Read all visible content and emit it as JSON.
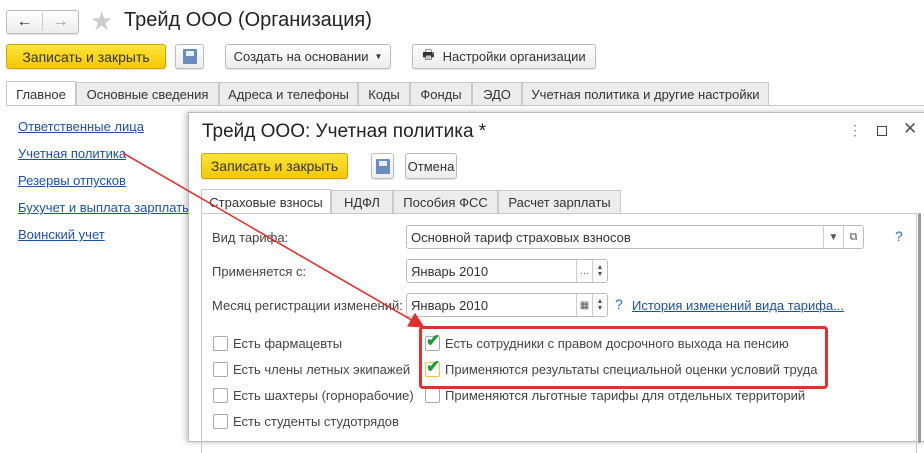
{
  "main": {
    "title": "Трейд ООО (Организация)",
    "save_close": "Записать и закрыть",
    "create_based": "Создать на основании",
    "org_settings": "Настройки организации",
    "tabs": [
      "Главное",
      "Основные сведения",
      "Адреса и телефоны",
      "Коды",
      "Фонды",
      "ЭДО",
      "Учетная политика и другие настройки"
    ]
  },
  "sidebar": {
    "links": [
      "Ответственные лица",
      "Учетная политика",
      "Резервы отпусков",
      "Бухучет и выплата зарплаты",
      "Воинский учет"
    ]
  },
  "dialog": {
    "title": "Трейд ООО: Учетная политика *",
    "save_close": "Записать и закрыть",
    "cancel": "Отмена",
    "tabs": [
      "Страховые взносы",
      "НДФЛ",
      "Пособия ФСС",
      "Расчет зарплаты"
    ],
    "fields": {
      "tariff_label": "Вид тарифа:",
      "tariff_value": "Основной тариф страховых взносов",
      "applies_label": "Применяется с:",
      "applies_value": "Январь 2010",
      "month_label": "Месяц регистрации изменений:",
      "month_value": "Январь 2010",
      "help": "?",
      "history_link": "История изменений вида тарифа..."
    },
    "checkboxes_left": [
      {
        "label": "Есть фармацевты",
        "checked": false
      },
      {
        "label": "Есть члены летных экипажей",
        "checked": false
      },
      {
        "label": "Есть шахтеры (горнорабочие)",
        "checked": false
      },
      {
        "label": "Есть студенты студотрядов",
        "checked": false
      }
    ],
    "checkboxes_right": [
      {
        "label": "Есть сотрудники с правом досрочного выхода на пенсию",
        "checked": true
      },
      {
        "label": "Применяются результаты специальной оценки условий труда",
        "checked": true
      },
      {
        "label": "Применяются льготные тарифы для отдельных территорий",
        "checked": false
      }
    ]
  },
  "colors": {
    "accent": "#f5c800",
    "highlight": "#e03030",
    "link": "#1c51a8",
    "check": "#1a9a3a"
  }
}
